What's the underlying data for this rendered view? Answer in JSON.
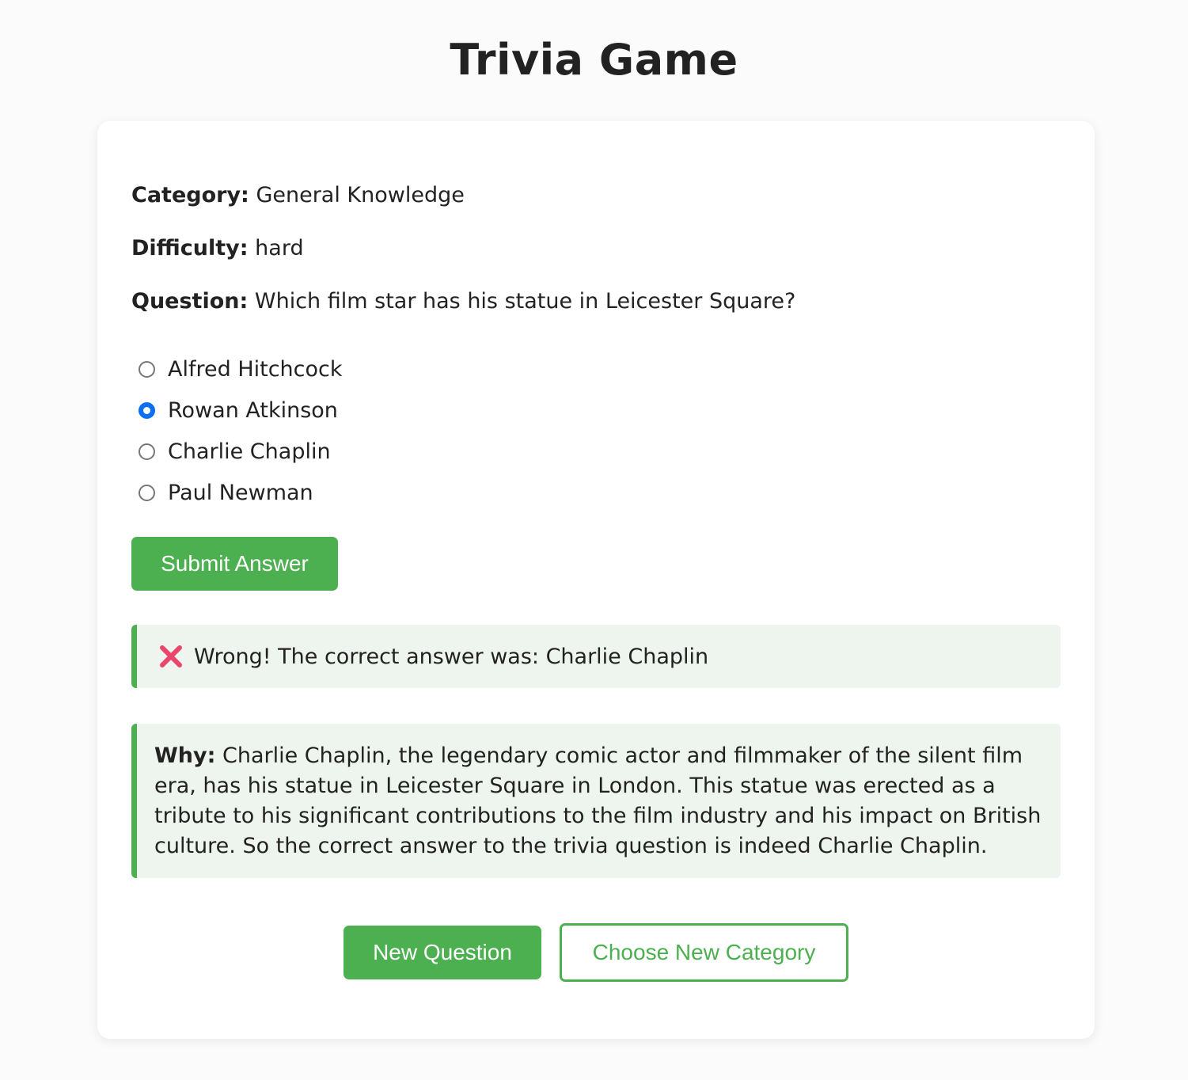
{
  "page": {
    "title": "Trivia Game"
  },
  "question": {
    "category_label": "Category:",
    "category": "General Knowledge",
    "difficulty_label": "Difficulty:",
    "difficulty": "hard",
    "question_label": "Question:",
    "text": "Which film star has his statue in Leicester Square?"
  },
  "options": [
    {
      "label": "Alfred Hitchcock",
      "selected": false
    },
    {
      "label": "Rowan Atkinson",
      "selected": true
    },
    {
      "label": "Charlie Chaplin",
      "selected": false
    },
    {
      "label": "Paul Newman",
      "selected": false
    }
  ],
  "buttons": {
    "submit": "Submit Answer",
    "new_question": "New Question",
    "choose_category": "Choose New Category"
  },
  "feedback": {
    "icon": "cross-mark-icon",
    "text": "Wrong! The correct answer was: Charlie Chaplin"
  },
  "explanation": {
    "label": "Why:",
    "text": "Charlie Chaplin, the legendary comic actor and filmmaker of the silent film era, has his statue in Leicester Square in London. This statue was erected as a tribute to his significant contributions to the film industry and his impact on British culture. So the correct answer to the trivia question is indeed Charlie Chaplin."
  },
  "colors": {
    "accent": "#4caf50",
    "radio_selected": "#0b6ff2",
    "feedback_bg": "#eef4ee",
    "error_icon": "#e8476b"
  }
}
